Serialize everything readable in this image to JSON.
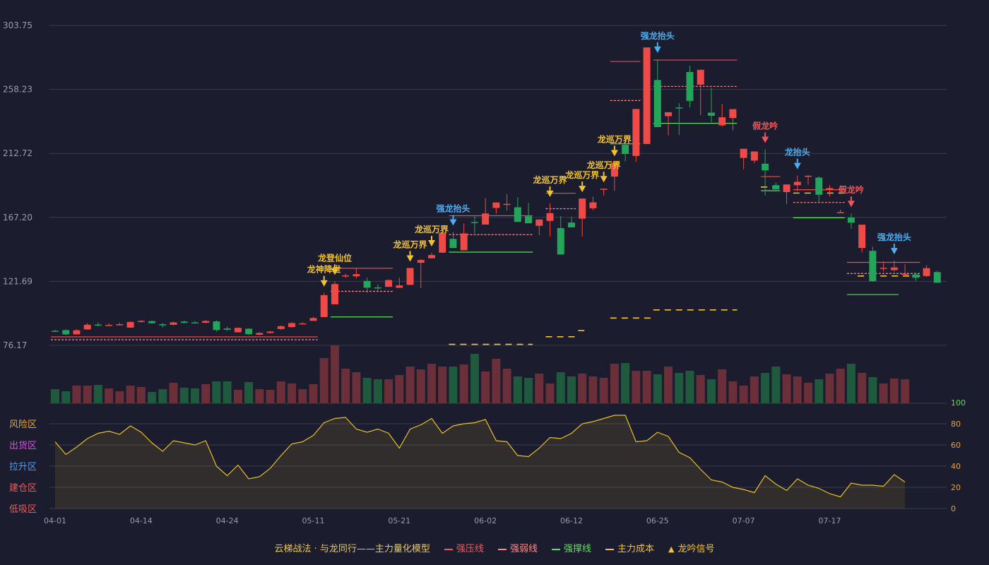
{
  "chart_data": [
    {
      "type": "candlestick",
      "y_ticks": [
        "303.75",
        "258.23",
        "212.72",
        "167.20",
        "121.69",
        "76.17"
      ],
      "ylim": [
        76.17,
        303.75
      ],
      "x_ticks": [
        {
          "label": "04-01",
          "index": 0
        },
        {
          "label": "04-14",
          "index": 8
        },
        {
          "label": "04-24",
          "index": 16
        },
        {
          "label": "05-11",
          "index": 24
        },
        {
          "label": "05-21",
          "index": 32
        },
        {
          "label": "06-02",
          "index": 40
        },
        {
          "label": "06-12",
          "index": 48
        },
        {
          "label": "06-25",
          "index": 56
        },
        {
          "label": "07-07",
          "index": 64
        },
        {
          "label": "07-17",
          "index": 72
        }
      ],
      "ohlc": [
        [
          86.5,
          87.2,
          85.8,
          86.1
        ],
        [
          87.0,
          87.6,
          83.5,
          84.0
        ],
        [
          84.0,
          87.8,
          84.0,
          86.9
        ],
        [
          87.5,
          92.0,
          87.2,
          90.8
        ],
        [
          91.0,
          92.6,
          89.8,
          90.4
        ],
        [
          90.6,
          92.0,
          90.2,
          90.7
        ],
        [
          90.6,
          92.2,
          90.3,
          91.2
        ],
        [
          88.8,
          93.2,
          88.6,
          92.8
        ],
        [
          93.0,
          94.1,
          92.3,
          93.6
        ],
        [
          93.4,
          94.0,
          91.6,
          91.9
        ],
        [
          91.2,
          92.2,
          89.0,
          90.4
        ],
        [
          90.8,
          93.0,
          90.6,
          92.5
        ],
        [
          93.1,
          93.7,
          91.7,
          92.2
        ],
        [
          92.5,
          93.5,
          91.8,
          92.4
        ],
        [
          92.2,
          94.2,
          91.9,
          93.5
        ],
        [
          93.2,
          94.1,
          86.0,
          87.1
        ],
        [
          88.2,
          89.6,
          86.6,
          87.3
        ],
        [
          85.5,
          89.0,
          85.3,
          88.6
        ],
        [
          88.0,
          88.4,
          83.5,
          84.1
        ],
        [
          83.7,
          85.5,
          83.2,
          85.0
        ],
        [
          85.0,
          86.4,
          84.5,
          86.0
        ],
        [
          87.8,
          90.3,
          87.1,
          89.8
        ],
        [
          89.2,
          92.7,
          88.9,
          92.0
        ],
        [
          91.4,
          92.6,
          91.1,
          91.8
        ],
        [
          93.6,
          96.4,
          94.0,
          95.6
        ],
        [
          96.3,
          113.5,
          96.3,
          111.9
        ],
        [
          105.4,
          121.7,
          105.3,
          119.8
        ],
        [
          125.3,
          127.3,
          124.2,
          125.9
        ],
        [
          125.3,
          130.6,
          123.7,
          126.8
        ],
        [
          122.0,
          124.5,
          113.6,
          117.2
        ],
        [
          117.4,
          119.6,
          115.4,
          116.8
        ],
        [
          117.8,
          123.1,
          117.8,
          122.6
        ],
        [
          117.1,
          124.3,
          117.1,
          118.8
        ],
        [
          119.2,
          130.6,
          119.0,
          131.2
        ],
        [
          134.9,
          137.6,
          116.8,
          136.9
        ],
        [
          138.1,
          142.0,
          138.3,
          140.4
        ],
        [
          142.1,
          156.9,
          141.9,
          156.4
        ],
        [
          151.9,
          156.8,
          148.9,
          145.5
        ],
        [
          143.8,
          162.9,
          143.8,
          155.8
        ],
        [
          163.9,
          168.6,
          156.0,
          163.6
        ],
        [
          162.1,
          180.9,
          162.4,
          170.0
        ],
        [
          173.9,
          176.5,
          169.9,
          177.8
        ],
        [
          176.8,
          183.7,
          172.1,
          176.8
        ],
        [
          174.4,
          181.6,
          170.7,
          164.0
        ],
        [
          168.0,
          177.5,
          163.7,
          163.0
        ],
        [
          161.2,
          162.6,
          154.6,
          165.7
        ],
        [
          164.7,
          177.2,
          153.7,
          170.2
        ],
        [
          159.6,
          168.2,
          159.0,
          140.8
        ],
        [
          163.5,
          167.7,
          163.0,
          160.1
        ],
        [
          166.3,
          166.5,
          153.6,
          180.6
        ],
        [
          173.7,
          181.9,
          172.2,
          177.9
        ],
        [
          187.3,
          187.3,
          182.9,
          187.6
        ],
        [
          196.2,
          201.3,
          186.1,
          206.1
        ],
        [
          218.8,
          223.3,
          207.0,
          212.3
        ],
        [
          210.9,
          235.4,
          206.7,
          244.3
        ],
        [
          219.4,
          269.6,
          227.9,
          288.1
        ],
        [
          264.9,
          279.7,
          261.1,
          231.4
        ],
        [
          239.2,
          240.4,
          225.6,
          242.0
        ],
        [
          245.4,
          248.5,
          225.8,
          245.1
        ],
        [
          270.6,
          275.1,
          245.5,
          250.1
        ],
        [
          261.6,
          268.4,
          239.9,
          272.2
        ],
        [
          241.7,
          259.4,
          234.9,
          239.5
        ],
        [
          232.7,
          248.0,
          231.7,
          238.4
        ],
        [
          237.9,
          239.2,
          229.1,
          244.2
        ],
        [
          209.5,
          212.9,
          201.4,
          216.0
        ],
        [
          207.6,
          208.5,
          205.8,
          214.1
        ],
        [
          205.4,
          215.6,
          182.8,
          200.6
        ],
        [
          190.1,
          191.9,
          190.0,
          187.1
        ],
        [
          185.2,
          189.5,
          176.7,
          190.6
        ],
        [
          190.1,
          196.9,
          185.9,
          192.5
        ],
        [
          196.5,
          197.3,
          190.4,
          196.8
        ],
        [
          195.5,
          196.5,
          178.3,
          183.3
        ],
        [
          186.8,
          190.1,
          182.1,
          188.0
        ],
        [
          170.8,
          172.7,
          170.6,
          170.9
        ],
        [
          167.1,
          170.0,
          159.1,
          163.4
        ],
        [
          145.5,
          155.1,
          142.3,
          162.0
        ],
        [
          143.4,
          146.3,
          121.3,
          121.8
        ],
        [
          131.3,
          135.8,
          128.7,
          131.3
        ],
        [
          129.7,
          136.4,
          128.8,
          131.6
        ],
        [
          126.3,
          133.9,
          125.4,
          127.2
        ],
        [
          126.6,
          127.9,
          122.0,
          124.3
        ],
        [
          125.5,
          133.1,
          124.9,
          131.1
        ],
        [
          128.3,
          129.3,
          120.8,
          120.7
        ]
      ],
      "volume_colors": [
        "up",
        "down"
      ],
      "volumes": [
        20,
        17,
        25,
        25,
        26,
        21,
        17,
        25,
        23,
        16,
        20,
        29,
        22,
        21,
        27,
        31,
        31,
        19,
        30,
        20,
        19,
        31,
        28,
        20,
        27,
        64,
        82,
        49,
        44,
        36,
        34,
        34,
        40,
        52,
        48,
        56,
        52,
        52,
        55,
        70,
        45,
        63,
        49,
        38,
        36,
        42,
        28,
        44,
        38,
        42,
        38,
        36,
        56,
        57,
        46,
        46,
        41,
        52,
        43,
        46,
        40,
        34,
        48,
        31,
        25,
        38,
        43,
        52,
        41,
        38,
        29,
        34,
        42,
        49,
        56,
        43,
        37,
        28,
        35,
        34
      ],
      "indicator": [
        63,
        51,
        58,
        66,
        71,
        73,
        70,
        78,
        72,
        62,
        54,
        64,
        62,
        60,
        64,
        40,
        31,
        41,
        28,
        30,
        38,
        50,
        61,
        63,
        69,
        81,
        85,
        86,
        75,
        72,
        75,
        71,
        57,
        75,
        79,
        85,
        71,
        78,
        80,
        81,
        84,
        64,
        63,
        50,
        49,
        57,
        67,
        66,
        71,
        80,
        82,
        85,
        88,
        88,
        63,
        64,
        72,
        68,
        53,
        48,
        37,
        27,
        25,
        20,
        18,
        15,
        31,
        23,
        17,
        28,
        22,
        19,
        14,
        11,
        24,
        22,
        22,
        21,
        32,
        25
      ],
      "indicator_ticks": [
        "100",
        "80",
        "60",
        "40",
        "20",
        "0"
      ],
      "zones": [
        {
          "label": "风险区",
          "color": "#e8a23a"
        },
        {
          "label": "出货区",
          "color": "#d84fe0"
        },
        {
          "label": "拉升区",
          "color": "#4a9ff0"
        },
        {
          "label": "建仓区",
          "color": "#ef5a5a"
        },
        {
          "label": "低吸区",
          "color": "#ef5a5a"
        }
      ],
      "signals": [
        {
          "index": 25,
          "text": "龙神降世",
          "kind": "gold"
        },
        {
          "index": 26,
          "text": "龙登仙位",
          "kind": "gold"
        },
        {
          "index": 33,
          "text": "龙巡万界",
          "kind": "gold"
        },
        {
          "index": 35,
          "text": "龙巡万界",
          "kind": "gold"
        },
        {
          "index": 37,
          "text": "强龙抬头",
          "kind": "blue"
        },
        {
          "index": 46,
          "text": "龙巡万界",
          "kind": "gold"
        },
        {
          "index": 49,
          "text": "龙巡万界",
          "kind": "gold"
        },
        {
          "index": 51,
          "text": "龙巡万界",
          "kind": "gold"
        },
        {
          "index": 52,
          "text": "龙巡万界",
          "kind": "gold"
        },
        {
          "index": 56,
          "text": "强龙抬头",
          "kind": "blue"
        },
        {
          "index": 66,
          "text": "假龙吟",
          "kind": "red"
        },
        {
          "index": 69,
          "text": "龙抬头",
          "kind": "blue"
        },
        {
          "index": 74,
          "text": "假龙吟",
          "kind": "red"
        },
        {
          "index": 78,
          "text": "强龙抬头",
          "kind": "blue"
        }
      ],
      "level_lines": [
        {
          "type": "resistance",
          "from": 0,
          "to": 24,
          "value": 82.2
        },
        {
          "type": "weak",
          "from": 0,
          "to": 24,
          "value": 80.2
        },
        {
          "type": "resistance",
          "from": 26,
          "to": 31,
          "value": 131.0
        },
        {
          "type": "weak",
          "from": 26,
          "to": 31,
          "value": 114.6
        },
        {
          "type": "support",
          "from": 26,
          "to": 31,
          "value": 96.4
        },
        {
          "type": "resistance",
          "from": 37,
          "to": 44,
          "value": 168.4
        },
        {
          "type": "weak",
          "from": 37,
          "to": 44,
          "value": 154.9
        },
        {
          "type": "support",
          "from": 37,
          "to": 44,
          "value": 142.5
        },
        {
          "type": "resistance",
          "from": 46,
          "to": 48,
          "value": 184.4
        },
        {
          "type": "weak",
          "from": 46,
          "to": 48,
          "value": 173.4
        },
        {
          "type": "resistance",
          "from": 52,
          "to": 54,
          "value": 278.1
        },
        {
          "type": "weak",
          "from": 52,
          "to": 54,
          "value": 250.3
        },
        {
          "type": "support",
          "from": 52,
          "to": 54,
          "value": 219.5
        },
        {
          "type": "resistance",
          "from": 56,
          "to": 63,
          "value": 279.1
        },
        {
          "type": "weak",
          "from": 56,
          "to": 63,
          "value": 260.4
        },
        {
          "type": "support",
          "from": 56,
          "to": 63,
          "value": 234.1
        },
        {
          "type": "resistance",
          "from": 66,
          "to": 67,
          "value": 196.2
        },
        {
          "type": "support",
          "from": 66,
          "to": 67,
          "value": 186.2
        },
        {
          "type": "resistance",
          "from": 69,
          "to": 73,
          "value": 186.9
        },
        {
          "type": "weak",
          "from": 69,
          "to": 73,
          "value": 177.8
        },
        {
          "type": "support",
          "from": 69,
          "to": 73,
          "value": 166.9
        },
        {
          "type": "resistance",
          "from": 74,
          "to": 80,
          "value": 135.2
        },
        {
          "type": "weak",
          "from": 74,
          "to": 80,
          "value": 127.3
        },
        {
          "type": "support",
          "from": 74,
          "to": 78,
          "value": 112.3
        }
      ],
      "cost_lines": [
        {
          "from": 37,
          "to": 44,
          "value": 76.9
        },
        {
          "from": 46,
          "to": 48,
          "value": 82.3
        },
        {
          "from": 49,
          "to": 49,
          "value": 86.7
        },
        {
          "from": 52,
          "to": 55,
          "value": 95.6
        },
        {
          "from": 56,
          "to": 63,
          "value": 101.4
        },
        {
          "from": 66,
          "to": 67,
          "value": 188.8
        },
        {
          "from": 69,
          "to": 73,
          "value": 184.5
        },
        {
          "from": 75,
          "to": 80,
          "value": 125.5
        }
      ],
      "legend": [
        {
          "label": "云梯战法 · 与龙同行——主力量化模型",
          "color": "#e8c75a",
          "style": "none"
        },
        {
          "label": "强压线",
          "color": "#ef5a5a",
          "style": "solid"
        },
        {
          "label": "强弱线",
          "color": "#ff8a8a",
          "style": "dash"
        },
        {
          "label": "强撑线",
          "color": "#5ae05a",
          "style": "solid"
        },
        {
          "label": "主力成本",
          "color": "#f2c230",
          "style": "dash"
        },
        {
          "label": "龙吟信号",
          "color": "#f2c230",
          "style": "triangle"
        }
      ],
      "colors": {
        "up": "#ef4a45",
        "down": "#23a55a",
        "vol_up": "#6a2f38",
        "vol_down": "#1f5a3e",
        "grid": "#3a3c4e",
        "axis_text": "#9a9cab",
        "indicator": "#e8c022",
        "signal_gold": "#f2c230",
        "signal_blue": "#4aaef2",
        "signal_red": "#f0565c"
      }
    }
  ]
}
